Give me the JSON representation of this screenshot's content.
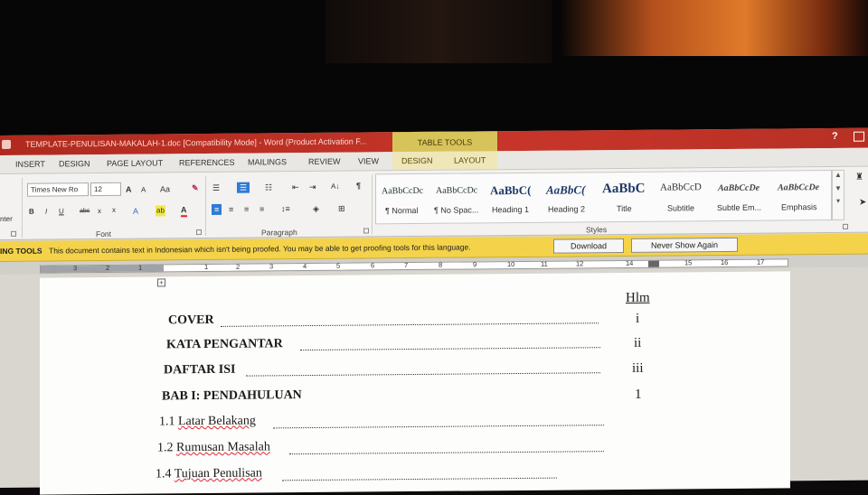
{
  "window": {
    "title": "TEMPLATE-PENULISAN-MAKALAH-1.doc [Compatibility Mode] - Word (Product Activation F...",
    "help": "?",
    "context_tab_group": "TABLE TOOLS"
  },
  "tabs": [
    "INSERT",
    "DESIGN",
    "PAGE LAYOUT",
    "REFERENCES",
    "MAILINGS",
    "REVIEW",
    "VIEW",
    "DESIGN",
    "LAYOUT"
  ],
  "ribbon": {
    "clipboard_partial_label": "nter",
    "font": {
      "name": "Times New Ro",
      "size": "12",
      "grow": "A",
      "shrink": "A",
      "case": "Aa",
      "bold": "B",
      "italic": "I",
      "underline": "U",
      "strike": "abc",
      "subscript": "x",
      "superscript": "x",
      "effects": "A",
      "highlight": "ab",
      "color": "A",
      "group_label": "Font"
    },
    "paragraph": {
      "pilcrow": "¶",
      "sort": "A↓",
      "group_label": "Paragraph"
    },
    "styles": {
      "group_label": "Styles",
      "items": [
        {
          "sample": "AaBbCcDc",
          "name": "¶ Normal"
        },
        {
          "sample": "AaBbCcDc",
          "name": "¶ No Spac..."
        },
        {
          "sample": "AaBbC(",
          "name": "Heading 1"
        },
        {
          "sample": "AaBbC(",
          "name": "Heading 2"
        },
        {
          "sample": "AaBbC",
          "name": "Title"
        },
        {
          "sample": "AaBbCcD",
          "name": "Subtitle"
        },
        {
          "sample": "AaBbCcDe",
          "name": "Subtle Em..."
        },
        {
          "sample": "AaBbCcDe",
          "name": "Emphasis"
        }
      ]
    }
  },
  "message_bar": {
    "label": "ING TOOLS",
    "text": "This document contains text in Indonesian which isn't being proofed. You may be able to get proofing tools for this language.",
    "download": "Download",
    "never_show": "Never Show Again"
  },
  "ruler": {
    "numbers": [
      "3",
      "2",
      "1",
      "1",
      "2",
      "3",
      "4",
      "5",
      "6",
      "7",
      "8",
      "9",
      "10",
      "11",
      "12",
      "14",
      "15",
      "16",
      "17"
    ]
  },
  "document": {
    "page_header": "Hlm",
    "toc": [
      {
        "text": "COVER",
        "page": "i"
      },
      {
        "text": "KATA PENGANTAR",
        "page": "ii"
      },
      {
        "text": "DAFTAR ISI",
        "page": "iii"
      },
      {
        "text": "BAB I: PENDAHULUAN",
        "page": "1"
      },
      {
        "num": "1.1",
        "text": "Latar Belakang",
        "page": ""
      },
      {
        "num": "1.2",
        "text": "Rumusan Masalah",
        "page": ""
      },
      {
        "num": "1.4",
        "text": "Tujuan Penulisan",
        "page": ""
      }
    ]
  }
}
